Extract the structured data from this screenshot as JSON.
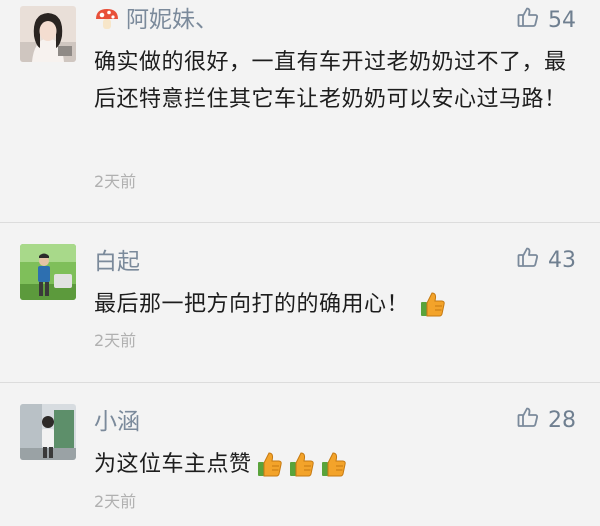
{
  "comments": [
    {
      "username": "阿妮妹、",
      "has_badge": true,
      "likes": "54",
      "content": "确实做的很好，一直有车开过老奶奶过不了，最后还特意拦住其它车让老奶奶可以安心过马路！",
      "time": "2天前",
      "emoji_count": 0
    },
    {
      "username": "白起",
      "has_badge": false,
      "likes": "43",
      "content": "最后那一把方向打的的确用心！",
      "time": "2天前",
      "emoji_count": 1
    },
    {
      "username": "小涵",
      "has_badge": false,
      "likes": "28",
      "content": "为这位车主点赞",
      "time": "2天前",
      "emoji_count": 3
    }
  ],
  "colors": {
    "background": "#f3f3f3",
    "username": "#7b8a9b",
    "like_count": "#6f7f90",
    "content": "#1d1d1d",
    "timestamp": "#b0b0b0",
    "emoji_thumb": "#f3a32a"
  },
  "icons": {
    "like": "thumbs-up-outline-icon",
    "badge": "mushroom-icon",
    "emoji": "thumbs-up-emoji-icon"
  }
}
